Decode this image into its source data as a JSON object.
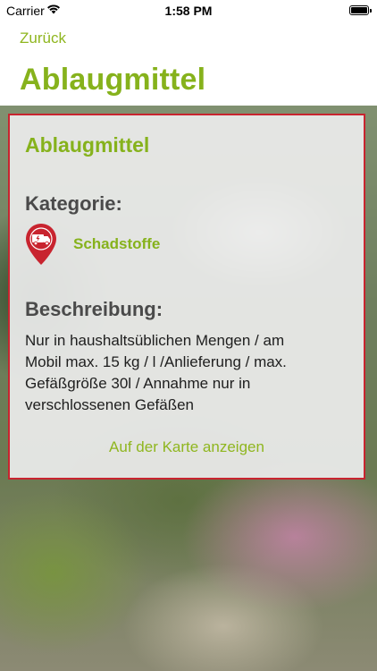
{
  "status_bar": {
    "carrier": "Carrier",
    "time": "1:58 PM"
  },
  "nav": {
    "back_label": "Zurück",
    "title": "Ablaugmittel"
  },
  "card": {
    "title": "Ablaugmittel",
    "category_heading": "Kategorie:",
    "category_name": "Schadstoffe",
    "category_icon": "hazmat-truck-pin-icon",
    "description_heading": "Beschreibung:",
    "description_lines": [
      "Nur in haushaltsüblichen Mengen / am",
      "Mobil max. 15 kg / l /Anlieferung / max.",
      "Gefäßgröße 30l / Annahme nur in",
      "verschlossenen Gefäßen"
    ],
    "map_link": "Auf der Karte anzeigen"
  },
  "colors": {
    "accent_green": "#86b21c",
    "card_border": "#c8242f",
    "pin_red": "#c8242f"
  }
}
